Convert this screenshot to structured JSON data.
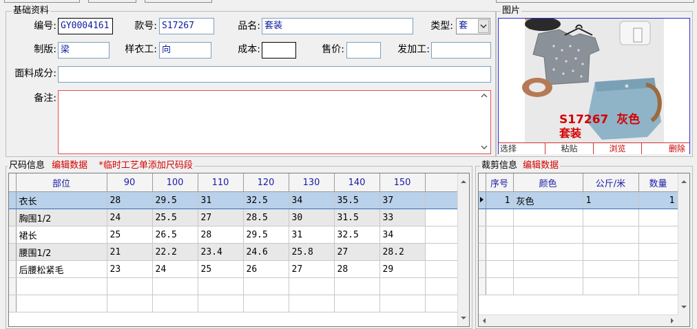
{
  "basic": {
    "legend": "基础资料",
    "code_label": "编号:",
    "code_value": "GY0004161",
    "style_label": "款号:",
    "style_value": "S17267",
    "name_label": "品名:",
    "name_value": "套装",
    "type_label": "类型:",
    "type_value": "套",
    "plate_label": "制版:",
    "plate_value": "梁",
    "sample_label": "样衣工:",
    "sample_value": "向",
    "cost_label": "成本:",
    "cost_value": "",
    "price_label": "售价:",
    "price_value": "",
    "process_label": "发加工:",
    "process_value": "",
    "fabric_label": "面料成分:",
    "fabric_value": "",
    "note_label": "备注:",
    "note_value": ""
  },
  "photo": {
    "legend": "图片",
    "caption_line1": "S17267  灰色",
    "caption_line2": "套装",
    "buttons": [
      "选择",
      "粘贴",
      "浏览",
      "删除"
    ]
  },
  "size": {
    "legend": "尺码信息",
    "edit_link": "编辑数据",
    "temp_link": "*临时工艺单添加尺码段",
    "columns": [
      "部位",
      "90",
      "100",
      "110",
      "120",
      "130",
      "140",
      "150"
    ],
    "rows": [
      [
        "衣长",
        "28",
        "29.5",
        "31",
        "32.5",
        "34",
        "35.5",
        "37"
      ],
      [
        "胸围1/2",
        "24",
        "25.5",
        "27",
        "28.5",
        "30",
        "31.5",
        "33"
      ],
      [
        "裙长",
        "25",
        "26.5",
        "28",
        "29.5",
        "31",
        "32.5",
        "34"
      ],
      [
        "腰围1/2",
        "21",
        "22.2",
        "23.4",
        "24.6",
        "25.8",
        "27",
        "28.2"
      ],
      [
        "后腰松紧毛",
        "23",
        "24",
        "25",
        "26",
        "27",
        "28",
        "29"
      ]
    ]
  },
  "cut": {
    "legend": "裁剪信息",
    "edit_link": "编辑数据",
    "columns": [
      "序号",
      "颜色",
      "公斤/米",
      "数量"
    ],
    "rows": [
      [
        "1",
        "灰色",
        "1",
        "1"
      ]
    ]
  }
}
